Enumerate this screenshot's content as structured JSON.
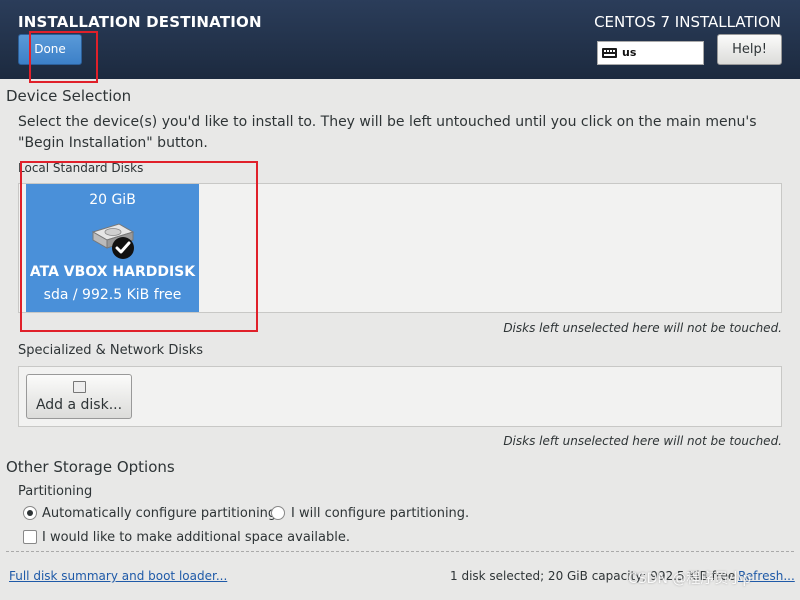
{
  "header": {
    "title": "INSTALLATION DESTINATION",
    "product": "CENTOS 7 INSTALLATION",
    "done_label": "Done",
    "keyboard_layout": "us",
    "help_label": "Help!"
  },
  "device_selection": {
    "title": "Device Selection",
    "instructions_line1": "Select the device(s) you'd like to install to.  They will be left untouched until you click on the main menu's",
    "instructions_line2": "\"Begin Installation\" button.",
    "local_disks_label": "Local Standard Disks",
    "disk": {
      "size": "20 GiB",
      "name": "ATA VBOX HARDDISK",
      "info": "sda   /   992.5 KiB free",
      "selected": true
    },
    "note_local": "Disks left unselected here will not be touched.",
    "specialized_label": "Specialized & Network Disks",
    "add_disk_label": "Add a disk...",
    "note_specialized": "Disks left unselected here will not be touched."
  },
  "other_storage": {
    "title": "Other Storage Options",
    "partitioning_label": "Partitioning",
    "auto_label": "Automatically configure partitioning.",
    "manual_label": "I will configure partitioning.",
    "space_label": "I would like to make additional space available."
  },
  "footer": {
    "summary_link": "Full disk summary and boot loader...",
    "summary_text": "1 disk selected; 20 GiB capacity; 992.5 KiB free",
    "refresh_label": "Refresh..."
  },
  "watermark": "CSDN @程序员小p",
  "colors": {
    "accent": "#4a90d9",
    "header": "#233350",
    "annotation": "#e0202a"
  }
}
